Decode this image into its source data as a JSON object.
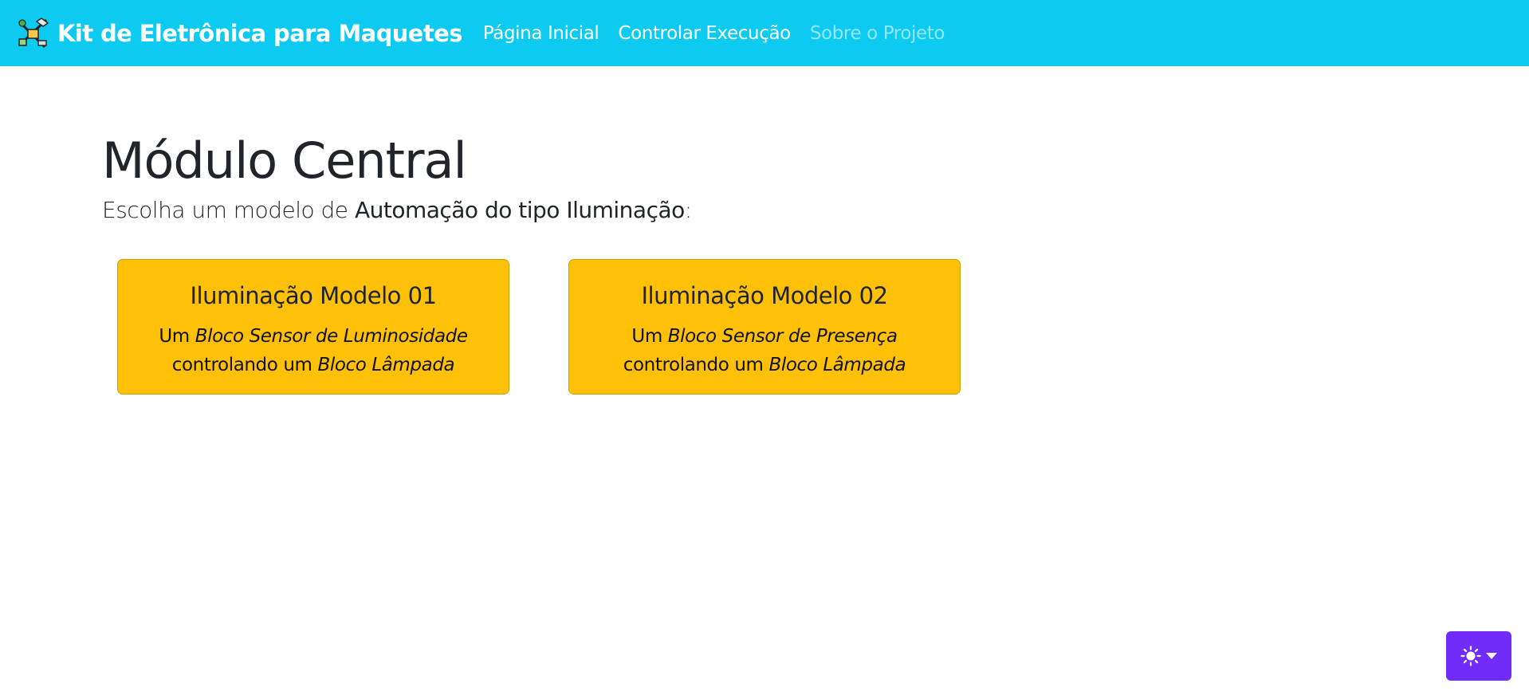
{
  "navbar": {
    "brand_logo": "circuit-kit-logo-icon",
    "brand_title": "Kit de Eletrônica para Maquetes",
    "links": [
      {
        "label": "Página Inicial",
        "state": "normal"
      },
      {
        "label": "Controlar Execução",
        "state": "normal"
      },
      {
        "label": "Sobre o Projeto",
        "state": "disabled"
      }
    ],
    "color": "#0dcaf0"
  },
  "main": {
    "title": "Módulo Central",
    "lead_prefix": "Escolha um modelo de ",
    "lead_emphasis": "Automação do tipo Iluminação",
    "lead_suffix": ":"
  },
  "cards": [
    {
      "title": "Iluminação Modelo 01",
      "text_1": "Um ",
      "italic_1": "Bloco Sensor de Luminosidade",
      "text_2": " controlando um ",
      "italic_2": "Bloco Lâmpada"
    },
    {
      "title": "Iluminação Modelo 02",
      "text_1": "Um ",
      "italic_1": "Bloco Sensor de Presença",
      "text_2": " controlando um ",
      "italic_2": "Bloco Lâmpada"
    }
  ],
  "card_color": "#ffc107",
  "theme_toggle": {
    "icon": "sun-icon",
    "dropdown_icon": "caret-down-icon",
    "color": "#712cf9"
  }
}
